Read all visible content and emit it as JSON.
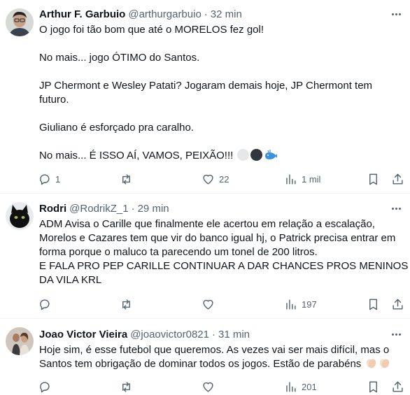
{
  "tweets": [
    {
      "name": "Arthur F. Garbuio",
      "handle": "@arthurgarbuio",
      "separator": "·",
      "time": "32 min",
      "lines": [
        "O jogo foi tão bom que até o MORELOS fez gol!",
        "",
        "No mais... jogo ÓTIMO do Santos.",
        "",
        "JP Chermont e Wesley Patati? Jogaram demais hoje, JP Chermont tem",
        "futuro.",
        "",
        "Giuliano é esforçado pra caralho.",
        "",
        "No mais... É ISSO AÍ, VAMOS, PEIXÃO!!!"
      ],
      "emojis": [
        "white-circle-emoji",
        "black-circle-emoji",
        "whale-emoji"
      ],
      "replies": "1",
      "retweets": "",
      "likes": "22",
      "views": "1 mil"
    },
    {
      "name": "Rodri",
      "handle": "@RodrikZ_1",
      "separator": "·",
      "time": "29 min",
      "lines": [
        "ADM Avisa o Carille que finalmente ele acertou em relação a escalação,",
        "Morelos e Cazares tem que vir do banco igual hj, o Patrick precisa entrar em",
        "forma porque o maluco ta parecendo um tonel de 200 litros.",
        "E FALA PRO PEP CARILLE CONTINUAR A DAR CHANCES PROS MENINOS",
        "DA VILA KRL"
      ],
      "replies": "",
      "retweets": "",
      "likes": "",
      "views": "197"
    },
    {
      "name": "Joao Victor Vieira",
      "handle": "@joaovictor0821",
      "separator": "·",
      "time": "31 min",
      "lines": [
        "Hoje sim, é esse futebol que queremos. As vezes  vai ser mais difícil, mas o",
        "Santos tem obrigação de dominar todos os jogos. Estão de parabéns"
      ],
      "emojis": [
        "clapping-hands-emoji",
        "clapping-hands-emoji"
      ],
      "replies": "",
      "retweets": "",
      "likes": "",
      "views": "201"
    }
  ]
}
